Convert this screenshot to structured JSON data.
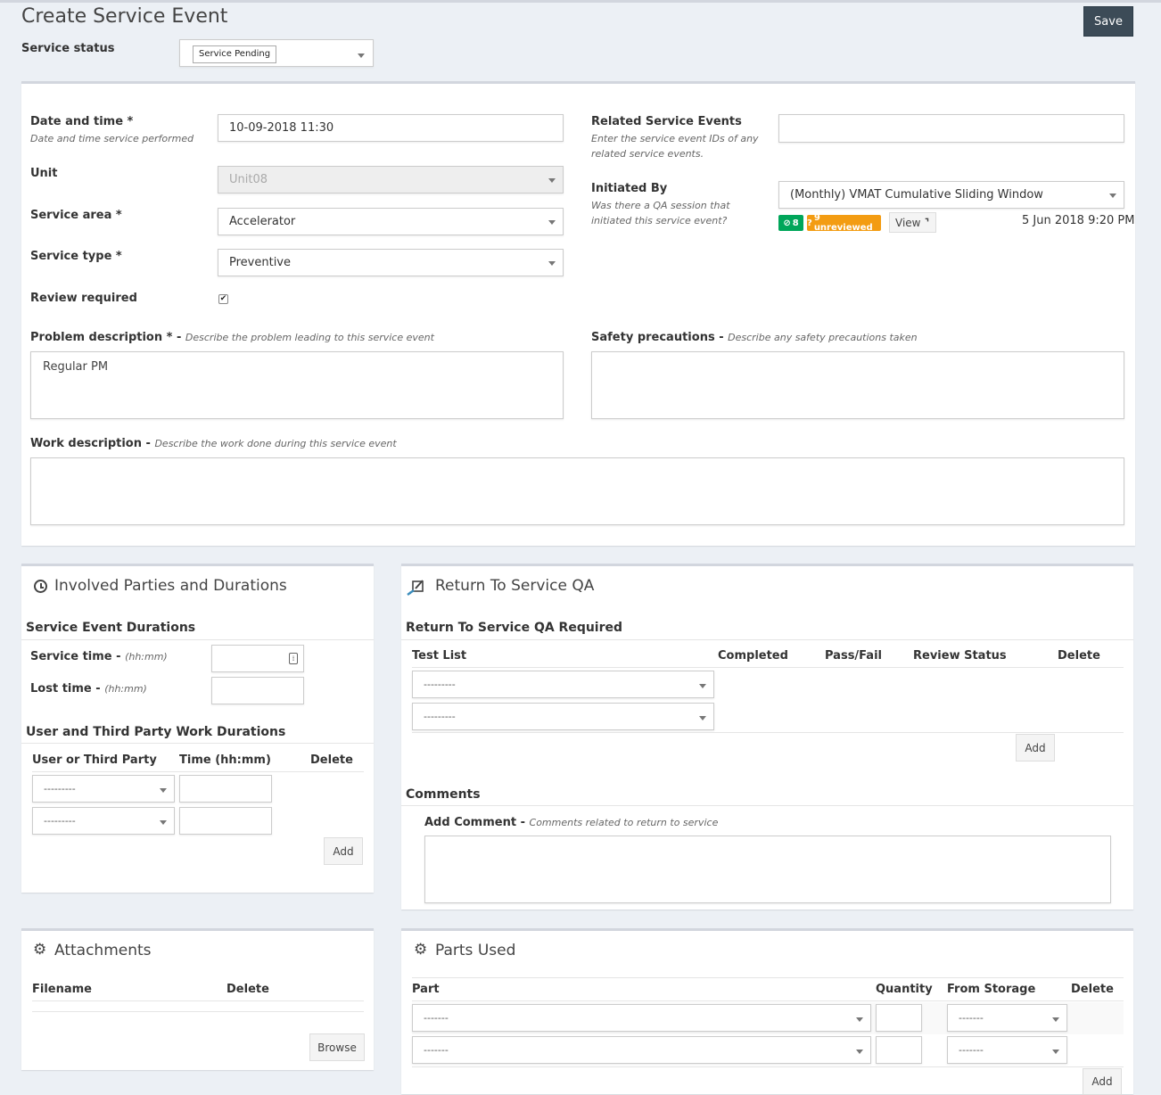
{
  "page": {
    "title": "Create Service Event",
    "save_label": "Save"
  },
  "service_status": {
    "label": "Service status",
    "value": "Service Pending"
  },
  "main_form": {
    "date_time": {
      "label": "Date and time *",
      "help": "Date and time service performed",
      "value": "10-09-2018 11:30"
    },
    "unit": {
      "label": "Unit",
      "value": "Unit08"
    },
    "service_area": {
      "label": "Service area *",
      "value": "Accelerator"
    },
    "service_type": {
      "label": "Service type *",
      "value": "Preventive"
    },
    "review_required": {
      "label": "Review required",
      "checked": true,
      "mark": "✔"
    },
    "problem_description": {
      "label": "Problem description *",
      "sep": " - ",
      "help": "Describe the problem leading to this service event",
      "value": "Regular PM"
    },
    "safety_precautions": {
      "label": "Safety precautions",
      "sep": " - ",
      "help": "Describe any safety precautions taken",
      "value": ""
    },
    "work_description": {
      "label": "Work description",
      "sep": " - ",
      "help": "Describe the work done during this service event",
      "value": ""
    },
    "related_events": {
      "label": "Related Service Events",
      "help_line1": "Enter the service event IDs of any",
      "help_line2": "related service events.",
      "value": ""
    },
    "initiated_by": {
      "label": "Initiated By",
      "help_line1": "Was there a QA session that",
      "help_line2": "initiated this service event?",
      "value": "(Monthly) VMAT Cumulative Sliding Window",
      "badge_ok": "8",
      "badge_unreviewed": "9 unreviewed",
      "view_label": "View",
      "timestamp": "5 Jun 2018 9:20 PM",
      "colors": {
        "ok": "#00a65a",
        "unreviewed": "#f39c12"
      }
    }
  },
  "involved": {
    "title": "Involved Parties and Durations",
    "durations_heading": "Service Event Durations",
    "service_time": {
      "label": "Service time",
      "sep": " - ",
      "help": "(hh:mm)"
    },
    "lost_time": {
      "label": "Lost time",
      "sep": " - ",
      "help": "(hh:mm)"
    },
    "work_heading": "User and Third Party Work Durations",
    "columns": [
      "User or Third Party",
      "Time (hh:mm)",
      "Delete"
    ],
    "rows": [
      {
        "user": "---------"
      },
      {
        "user": "---------"
      }
    ],
    "add_label": "Add"
  },
  "rtsqa": {
    "title": "Return To Service QA",
    "required_heading": "Return To Service QA Required",
    "columns": [
      "Test List",
      "Completed",
      "Pass/Fail",
      "Review Status",
      "Delete"
    ],
    "rows": [
      {
        "test_list": "---------"
      },
      {
        "test_list": "---------"
      }
    ],
    "add_label": "Add",
    "comments_heading": "Comments",
    "add_comment": {
      "label": "Add Comment",
      "sep": " - ",
      "help": "Comments related to return to service"
    }
  },
  "attachments": {
    "title": "Attachments",
    "columns": [
      "Filename",
      "Delete"
    ],
    "browse_label": "Browse"
  },
  "parts": {
    "title": "Parts Used",
    "columns": [
      "Part",
      "Quantity",
      "From Storage",
      "Delete"
    ],
    "rows": [
      {
        "part": "-------",
        "storage": "-------"
      },
      {
        "part": "-------",
        "storage": "-------"
      }
    ],
    "add_label": "Add"
  }
}
